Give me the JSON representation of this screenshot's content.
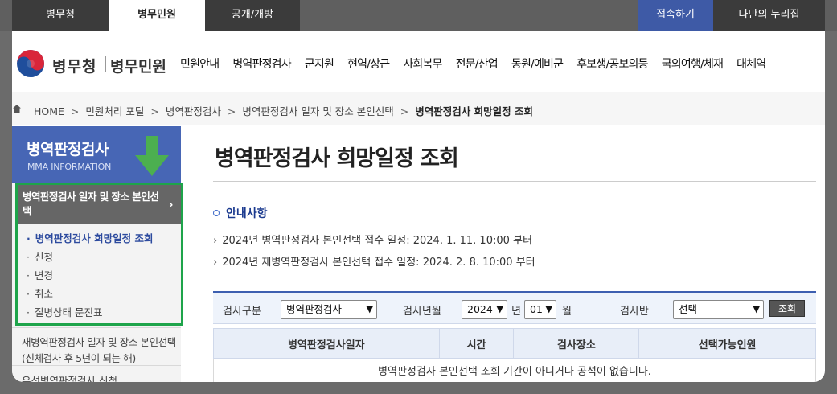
{
  "top_tabs": [
    "병무청",
    "병무민원",
    "공개/개방",
    "접속하기",
    "나만의 누리집"
  ],
  "logo": {
    "org": "병무청",
    "service": "병무민원"
  },
  "gnb": [
    "민원안내",
    "병역판정검사",
    "군지원",
    "현역/상근",
    "사회복무",
    "전문/산업",
    "동원/예비군",
    "후보생/공보의등",
    "국외여행/체재",
    "대체역"
  ],
  "breadcrumb": {
    "home": "HOME",
    "items": [
      "민원처리 포털",
      "병역판정검사",
      "병역판정검사 일자 및 장소 본인선택"
    ],
    "current": "병역판정검사 희망일정 조회"
  },
  "lnb": {
    "title": "병역판정검사",
    "subtitle": "MMA INFORMATION",
    "menu1": "병역판정검사 일자 및 장소 본인선택",
    "submenu": [
      "병역판정검사 희망일정 조회",
      "신청",
      "변경",
      "취소",
      "질병상태 문진표"
    ],
    "menu2": "재병역판정검사 일자 및 장소 본인선택(신체검사 후 5년이 되는 해)",
    "menu3": "우선병역판정검사 신청"
  },
  "main": {
    "title": "병역판정검사 희망일정 조회",
    "guide_title": "안내사항",
    "notice1": "2024년 병역판정검사 본인선택 접수 일정: 2024. 1. 11. 10:00 부터",
    "notice2": "2024년 재병역판정검사 본인선택 접수 일정: 2024. 2. 8. 10:00 부터"
  },
  "search": {
    "type_label": "검사구분",
    "type_value": "병역판정검사",
    "year_label": "검사년월",
    "year_value": "2024",
    "year_unit": "년",
    "month_value": "01",
    "month_unit": "월",
    "team_label": "검사반",
    "team_value": "선택",
    "button": "조회"
  },
  "table": {
    "headers": [
      "병역판정검사일자",
      "시간",
      "검사장소",
      "선택가능인원"
    ],
    "empty_message": "병역판정검사 본인선택 조회 기간이 아니거나 공석이 없습니다."
  },
  "colors": {
    "accent": "#4766b5",
    "highlight_box": "#1ea44a",
    "arrow": "#4caf50"
  },
  "icons": [
    "home-icon",
    "mma-emblem-icon",
    "green-down-arrow-icon",
    "chevron-right-icon"
  ]
}
